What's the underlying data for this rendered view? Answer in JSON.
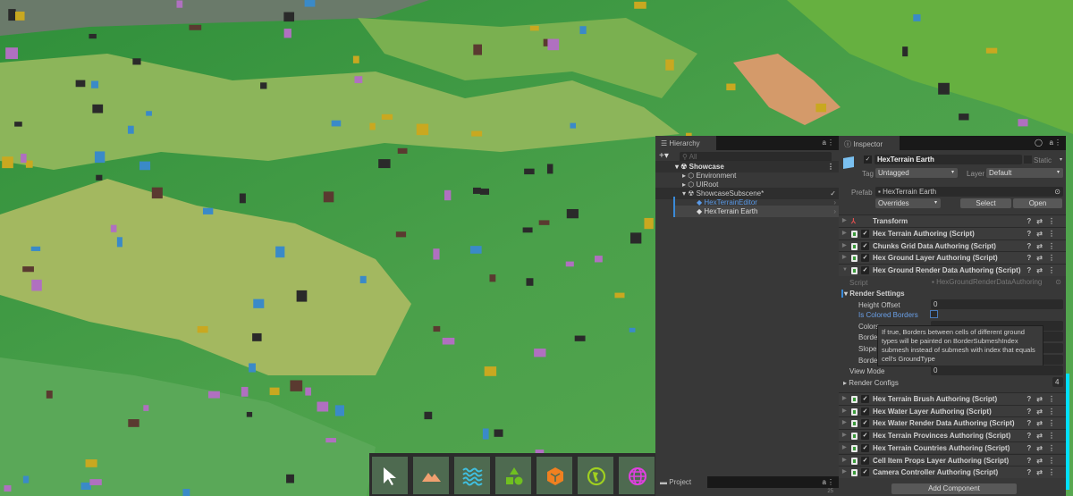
{
  "hierarchy": {
    "tab_label": "Hierarchy",
    "search_placeholder": "All",
    "items": [
      {
        "label": "Showcase"
      },
      {
        "label": "Environment"
      },
      {
        "label": "UIRoot"
      },
      {
        "label": "ShowcaseSubscene*"
      },
      {
        "label": "HexTerrainEditor"
      },
      {
        "label": "HexTerrain Earth"
      }
    ]
  },
  "project": {
    "tab_label": "Project",
    "badge": "25"
  },
  "inspector": {
    "tab_label": "Inspector",
    "object_name": "HexTerrain Earth",
    "static_label": "Static",
    "tag_label": "Tag",
    "tag_value": "Untagged",
    "layer_label": "Layer",
    "layer_value": "Default",
    "prefab_label": "Prefab",
    "prefab_value": "HexTerrain Earth",
    "overrides_label": "Overrides",
    "select_label": "Select",
    "open_label": "Open",
    "transform_label": "Transform",
    "components_top": [
      "Hex Terrain Authoring (Script)",
      "Chunks Grid Data Authoring (Script)",
      "Hex Ground Layer Authoring (Script)",
      "Hex Ground Render Data Authoring (Script)"
    ],
    "script_label": "Script",
    "script_value": "HexGroundRenderDataAuthoring",
    "render_settings_label": "Render Settings",
    "fields": {
      "height_offset_label": "Height Offset",
      "height_offset_value": "0",
      "is_colored_borders_label": "Is Colored Borders",
      "colors_label": "Colors",
      "border1_label": "Borde",
      "slope_label": "Slope",
      "border2_label": "Borde",
      "view_mode_label": "View Mode",
      "view_mode_value": "0",
      "render_configs_label": "Render Configs",
      "render_configs_count": "4"
    },
    "tooltip": "If true, Borders between cells of different ground types will be painted on BorderSubmeshIndex submesh instead of submesh with index that equals cell's GroundType",
    "components_bottom": [
      "Hex Terrain Brush Authoring (Script)",
      "Hex Water Layer Authoring (Script)",
      "Hex Water Render Data Authoring (Script)",
      "Hex Terrain Provinces Authoring (Script)",
      "Hex Terrain Countries Authoring (Script)",
      "Cell Item Props Layer Authoring (Script)",
      "Camera Controller Authoring (Script)"
    ],
    "add_component_label": "Add Component"
  },
  "toolbar": {
    "tools": [
      {
        "icon": "cursor-icon",
        "color": "#ffffff"
      },
      {
        "icon": "mountains-icon",
        "color": "#f0a070"
      },
      {
        "icon": "water-waves-icon",
        "color": "#40c0e0"
      },
      {
        "icon": "shapes-icon",
        "color": "#70c020"
      },
      {
        "icon": "cube-icon",
        "color": "#f08020"
      },
      {
        "icon": "globe-continent-icon",
        "color": "#a0d020"
      },
      {
        "icon": "globe-grid-icon",
        "color": "#e040e0"
      }
    ]
  },
  "colors": {
    "accent": "#4a8ee0",
    "selection": "#2c5d87",
    "cyan_bar": "#00e0ff"
  }
}
